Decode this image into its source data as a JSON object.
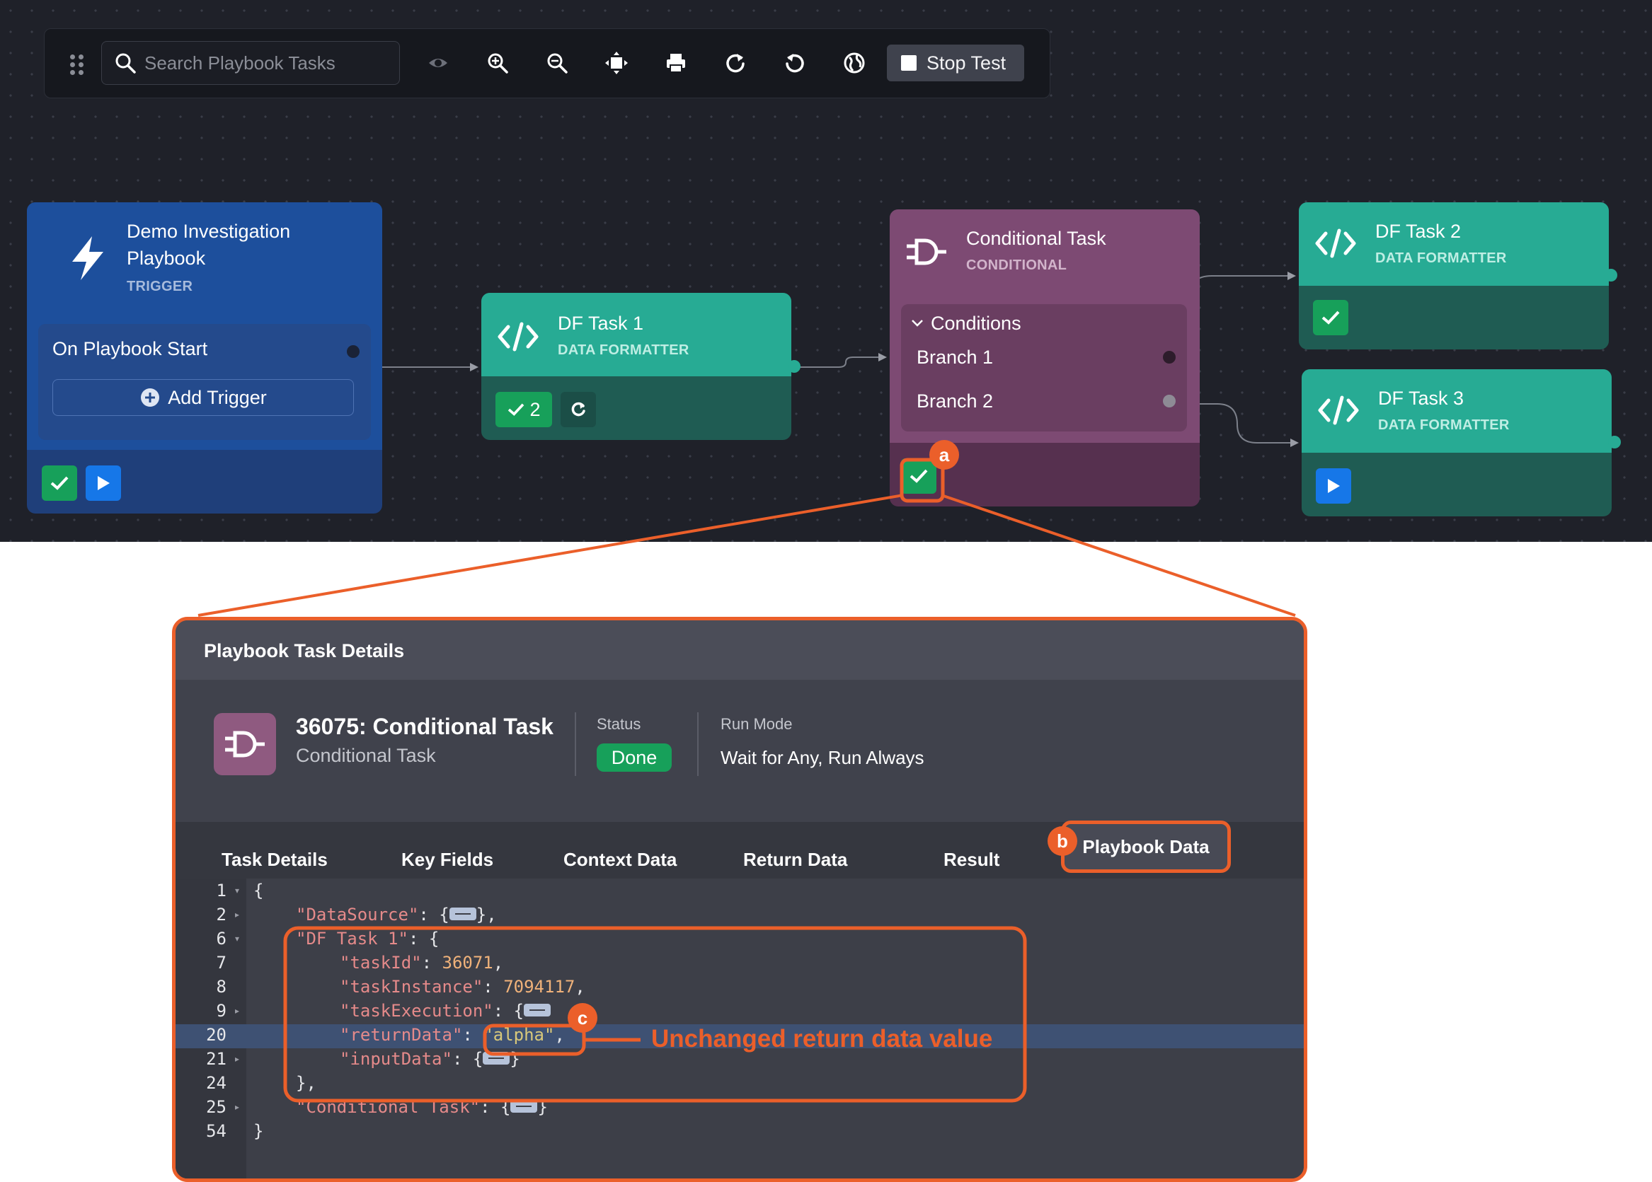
{
  "toolbar": {
    "search_placeholder": "Search Playbook Tasks",
    "icons": [
      "drag-handle-icon",
      "search-icon",
      "eye-icon",
      "zoom-in-icon",
      "zoom-out-icon",
      "fit-view-icon",
      "print-icon",
      "redo-icon",
      "undo-icon",
      "globe-icon"
    ],
    "stop_test_label": "Stop Test"
  },
  "nodes": {
    "trigger": {
      "title_line1": "Demo Investigation",
      "title_line2": "Playbook",
      "subtitle": "TRIGGER",
      "event_label": "On Playbook Start",
      "add_trigger_label": "Add Trigger"
    },
    "df_task_1": {
      "title": "DF Task 1",
      "subtitle": "DATA FORMATTER",
      "success_count": "2"
    },
    "conditional": {
      "title": "Conditional Task",
      "subtitle": "CONDITIONAL",
      "conditions_label": "Conditions",
      "branches": [
        "Branch 1",
        "Branch 2"
      ]
    },
    "df_task_2": {
      "title": "DF Task 2",
      "subtitle": "DATA FORMATTER"
    },
    "df_task_3": {
      "title": "DF Task 3",
      "subtitle": "DATA FORMATTER"
    }
  },
  "panel": {
    "title": "Playbook Task Details",
    "task_name": "36075: Conditional Task",
    "task_kind": "Conditional Task",
    "status_label": "Status",
    "status_value": "Done",
    "run_mode_label": "Run Mode",
    "run_mode_value": "Wait for Any, Run Always",
    "tabs": [
      "Task Details",
      "Key Fields",
      "Context Data",
      "Return Data",
      "Result",
      "Playbook Data"
    ],
    "active_tab": "Playbook Data"
  },
  "code": {
    "line_numbers": [
      "1",
      "2",
      "6",
      "7",
      "8",
      "9",
      "20",
      "21",
      "24",
      "25",
      "54"
    ],
    "highlighted_line": "20",
    "lines": {
      "l1": "{",
      "l2_key": "\"DataSource\"",
      "l2_tail": "},",
      "l6_key": "\"DF Task 1\"",
      "l6_tail": ": {",
      "l7_key": "\"taskId\"",
      "l7_val": "36071",
      "l8_key": "\"taskInstance\"",
      "l8_val": "7094117",
      "l9_key": "\"taskExecution\"",
      "l20_key": "\"returnData\"",
      "l20_val": "\"alpha\"",
      "l21_key": "\"inputData\"",
      "l21_tail": "}",
      "l24": "},",
      "l25_key": "\"Conditional Task\"",
      "l25_tail": "}",
      "l54": "}"
    }
  },
  "callouts": [
    "a",
    "b",
    "c"
  ],
  "annotation_text": "Unchanged return data value",
  "colors": {
    "canvas_bg": "#1f2129",
    "trigger_blue": "#1d4f9c",
    "teal": "#27ab94",
    "conditional_purple": "#7d4a73",
    "success_green": "#17a05a",
    "play_blue": "#1677e8",
    "callout_orange": "#eb5f2a"
  }
}
